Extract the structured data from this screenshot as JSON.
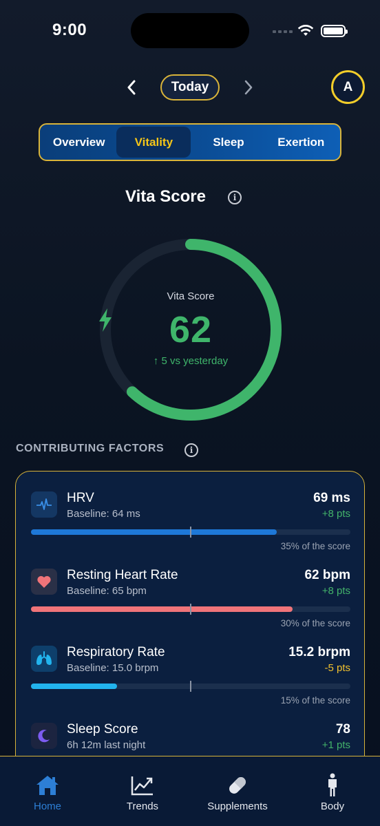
{
  "status_bar": {
    "time": "9:00"
  },
  "date_nav": {
    "label": "Today",
    "prev_icon": "chevron-left-icon",
    "next_icon": "chevron-right-icon"
  },
  "profile": {
    "initial": "A"
  },
  "tabs": [
    {
      "label": "Overview",
      "active": false
    },
    {
      "label": "Vitality",
      "active": true
    },
    {
      "label": "Sleep",
      "active": false
    },
    {
      "label": "Exertion",
      "active": false
    }
  ],
  "score": {
    "title": "Vita Score",
    "ring_label": "Vita Score",
    "value": "62",
    "value_numeric": 62,
    "max": 100,
    "delta": "↑ 5 vs yesterday",
    "color": "#3fb56b"
  },
  "factors_header": "CONTRIBUTING FACTORS",
  "factors": [
    {
      "name": "HRV",
      "baseline": "Baseline: 64 ms",
      "value": "69 ms",
      "points": "+8 pts",
      "points_color": "#43b36a",
      "share": "35% of the score",
      "fill_fraction": 0.77,
      "color": "#1e78d8",
      "icon": "heartbeat-icon"
    },
    {
      "name": "Resting Heart Rate",
      "baseline": "Baseline: 65 bpm",
      "value": "62 bpm",
      "points": "+8 pts",
      "points_color": "#43b36a",
      "share": "30% of the score",
      "fill_fraction": 0.82,
      "color": "#f07479",
      "icon": "heart-icon"
    },
    {
      "name": "Respiratory Rate",
      "baseline": "Baseline: 15.0 brpm",
      "value": "15.2 brpm",
      "points": "-5 pts",
      "points_color": "#f2c12e",
      "share": "15% of the score",
      "fill_fraction": 0.27,
      "color": "#22b4ee",
      "icon": "lungs-icon"
    },
    {
      "name": "Sleep Score",
      "baseline": "6h 12m last night",
      "value": "78",
      "points": "+1 pts",
      "points_color": "#43b36a",
      "share": "",
      "fill_fraction": 0,
      "color": "#7c5cf0",
      "icon": "moon-icon"
    }
  ],
  "bottom_nav": [
    {
      "label": "Home",
      "icon": "home-icon",
      "active": true
    },
    {
      "label": "Trends",
      "icon": "trends-icon",
      "active": false
    },
    {
      "label": "Supplements",
      "icon": "pill-icon",
      "active": false
    },
    {
      "label": "Body",
      "icon": "body-icon",
      "active": false
    }
  ]
}
